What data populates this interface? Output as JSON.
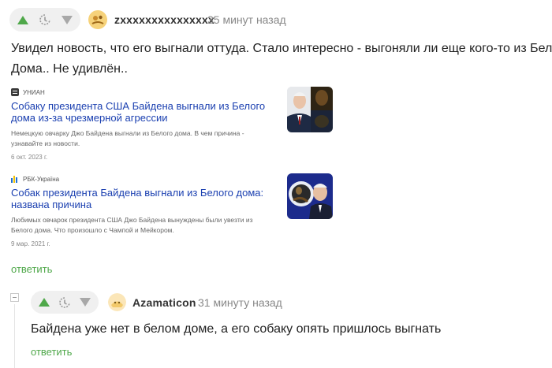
{
  "comment1": {
    "username": "zxxxxxxxxxxxxxxx",
    "time": "35 минут назад",
    "text_line1": "Увидел новость, что его выгнали оттуда. Стало интересно - выгоняли ли еще кого-то из Белого",
    "text_line2": "Дома.. Не удивлён..",
    "reply": "ответить"
  },
  "news": [
    {
      "source": "УНИАН",
      "title": "Собаку президента США Байдена выгнали из Белого дома из-за чрезмерной агрессии",
      "snippet": "Немецкую овчарку Джо Байдена выгнали из Белого дома. В чем причина - узнавайте из новости.",
      "date": "6 окт. 2023 г."
    },
    {
      "source": "РБК-Україна",
      "title": "Собак президента Байдена выгнали из Белого дома: названа причина",
      "snippet": "Любимых овчарок президента США Джо Байдена вынуждены были увезти из Белого дома. Что произошло с Чампой и Мейкором.",
      "date": "9 мар. 2021 г."
    }
  ],
  "comment2": {
    "username": "Azamaticon",
    "time": "31 минуту назад",
    "text": "Байдена уже нет в белом доме, а его собаку опять пришлось выгнать",
    "reply": "ответить"
  },
  "colors": {
    "upvote": "#4fa84a",
    "downvote": "#a8a8a8",
    "link": "#1a3fb0",
    "reply": "#4fa84a"
  }
}
